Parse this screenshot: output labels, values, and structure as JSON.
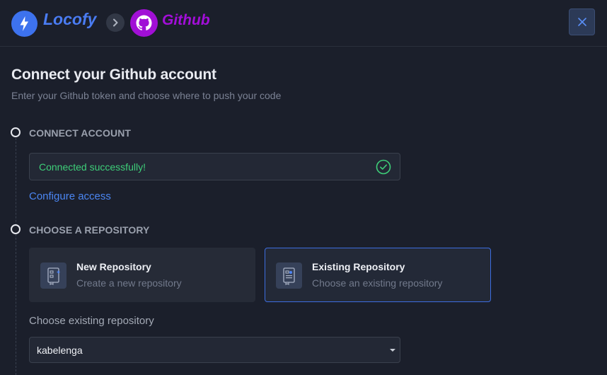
{
  "header": {
    "brand": "Locofy",
    "integration": "Github",
    "colors": {
      "brand": "#3d72ee",
      "github": "#a10fd6"
    },
    "icons": {
      "brand": "bolt-icon",
      "separator": "chevron-right-icon",
      "integration": "github-icon",
      "close": "close-icon"
    }
  },
  "page": {
    "title": "Connect your Github account",
    "subtitle": "Enter your Github token and choose where to push your code"
  },
  "steps": {
    "connect": {
      "title": "CONNECT ACCOUNT",
      "status": "Connected successfully!",
      "status_color": "#3ecf79",
      "status_icon": "check-circle-icon",
      "link": "Configure access"
    },
    "repository": {
      "title": "CHOOSE A REPOSITORY",
      "options": [
        {
          "title": "New Repository",
          "description": "Create a new repository",
          "icon": "new-repo-icon",
          "selected": false
        },
        {
          "title": "Existing Repository",
          "description": "Choose an existing repository",
          "icon": "existing-repo-icon",
          "selected": true
        }
      ],
      "select_label": "Choose existing repository",
      "select_value": "kabelenga"
    }
  }
}
